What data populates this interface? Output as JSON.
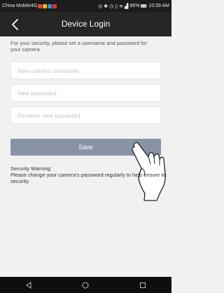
{
  "status_bar": {
    "carrier": "China Mobile4G",
    "battery": "86%",
    "time": "10:39 AM",
    "app_icon_colors": [
      "#e0492f",
      "#f2b51d",
      "#3b8be0",
      "#d93636"
    ]
  },
  "nav": {
    "back_icon": "back-arrow-icon",
    "title": "Device Login"
  },
  "form": {
    "intro": "For your security, please set a username and password for your camera",
    "username_placeholder": "New camera username",
    "password_placeholder": "New password",
    "confirm_placeholder": "Re-enter new password",
    "save_label": "Save"
  },
  "warning": {
    "title": "Security Warning:",
    "body": "Please change your camera's password regularly to help ensure its security."
  },
  "colors": {
    "nav_bg": "#262626",
    "page_bg": "#f1f1f1",
    "save_button": "#8a93a6",
    "system_nav_bg": "#0e0e0e"
  },
  "system_nav": {
    "icons": [
      "nav-back-triangle-icon",
      "nav-home-circle-icon",
      "nav-recents-square-icon"
    ]
  }
}
